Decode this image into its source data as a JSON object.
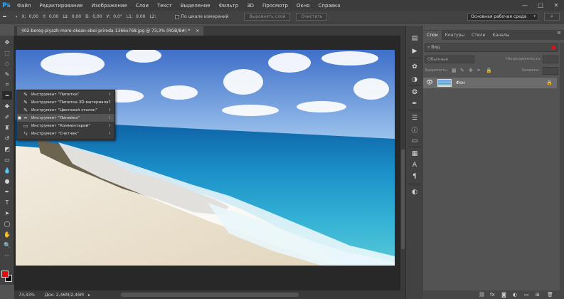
{
  "app": {
    "logo": "Ps"
  },
  "menu": [
    "Файл",
    "Редактирование",
    "Изображение",
    "Слои",
    "Текст",
    "Выделение",
    "Фильтр",
    "3D",
    "Просмотр",
    "Окно",
    "Справка"
  ],
  "window_controls": {
    "minimize": "—",
    "maximize": "□",
    "close": "✕"
  },
  "options": {
    "x_label": "X:",
    "x_value": "0,00",
    "y_label": "Y:",
    "y_value": "0,00",
    "w_label": "Ш:",
    "w_value": "0,00",
    "h_label": "В:",
    "h_value": "0,00",
    "a_label": "У:",
    "a_value": "0,0°",
    "l1_label": "L1:",
    "l1_value": "0,00",
    "l2_label": "L2:",
    "scale_checkbox": "По шкале измерений",
    "straighten_btn": "Выровнять слой",
    "clear_btn": "Очистить",
    "workspace": "Основная рабочая среда",
    "search_icon": "⌕"
  },
  "document": {
    "tab_title": "402-bereg-plyazh-more-okean-oboi-priroda-1366x768.jpg @ 73,3% (RGB/8#) *",
    "tab_close": "×",
    "zoom": "73,33%",
    "doc_info": "Док: 2,46M/2,46M",
    "status_arrow": "▸"
  },
  "flyout": [
    {
      "icon": "eyedropper-icon",
      "label": "Инструмент \"Пипетка\"",
      "key": "I",
      "selected": false
    },
    {
      "icon": "3d-eyedropper-icon",
      "label": "Инструмент \"Пипетка 3D-материала\"",
      "key": "I",
      "selected": false
    },
    {
      "icon": "color-sampler-icon",
      "label": "Инструмент \"Цветовой эталон\"",
      "key": "I",
      "selected": false
    },
    {
      "icon": "ruler-icon",
      "label": "Инструмент \"Линейка\"",
      "key": "I",
      "selected": true
    },
    {
      "icon": "note-icon",
      "label": "Инструмент \"Комментарий\"",
      "key": "I",
      "selected": false
    },
    {
      "icon": "count-icon",
      "label": "Инструмент \"Счетчик\"",
      "key": "I",
      "selected": false
    }
  ],
  "layers_panel": {
    "tabs": [
      "Слои",
      "Контуры",
      "Стили",
      "Каналы"
    ],
    "active_tab": 0,
    "panel_menu": "≡",
    "filter_kind": "Вид",
    "blend_mode": "Обычные",
    "opacity_label": "Непрозрачность:",
    "opacity_value": "",
    "lock_label": "Закрепить:",
    "fill_label": "Заливка:",
    "fill_value": "",
    "layers": [
      {
        "name": "Фон",
        "visible": true,
        "locked": true
      }
    ]
  },
  "colors": {
    "foreground": "#e10d0d",
    "background": "#000000",
    "accent": "#31a8ff"
  }
}
